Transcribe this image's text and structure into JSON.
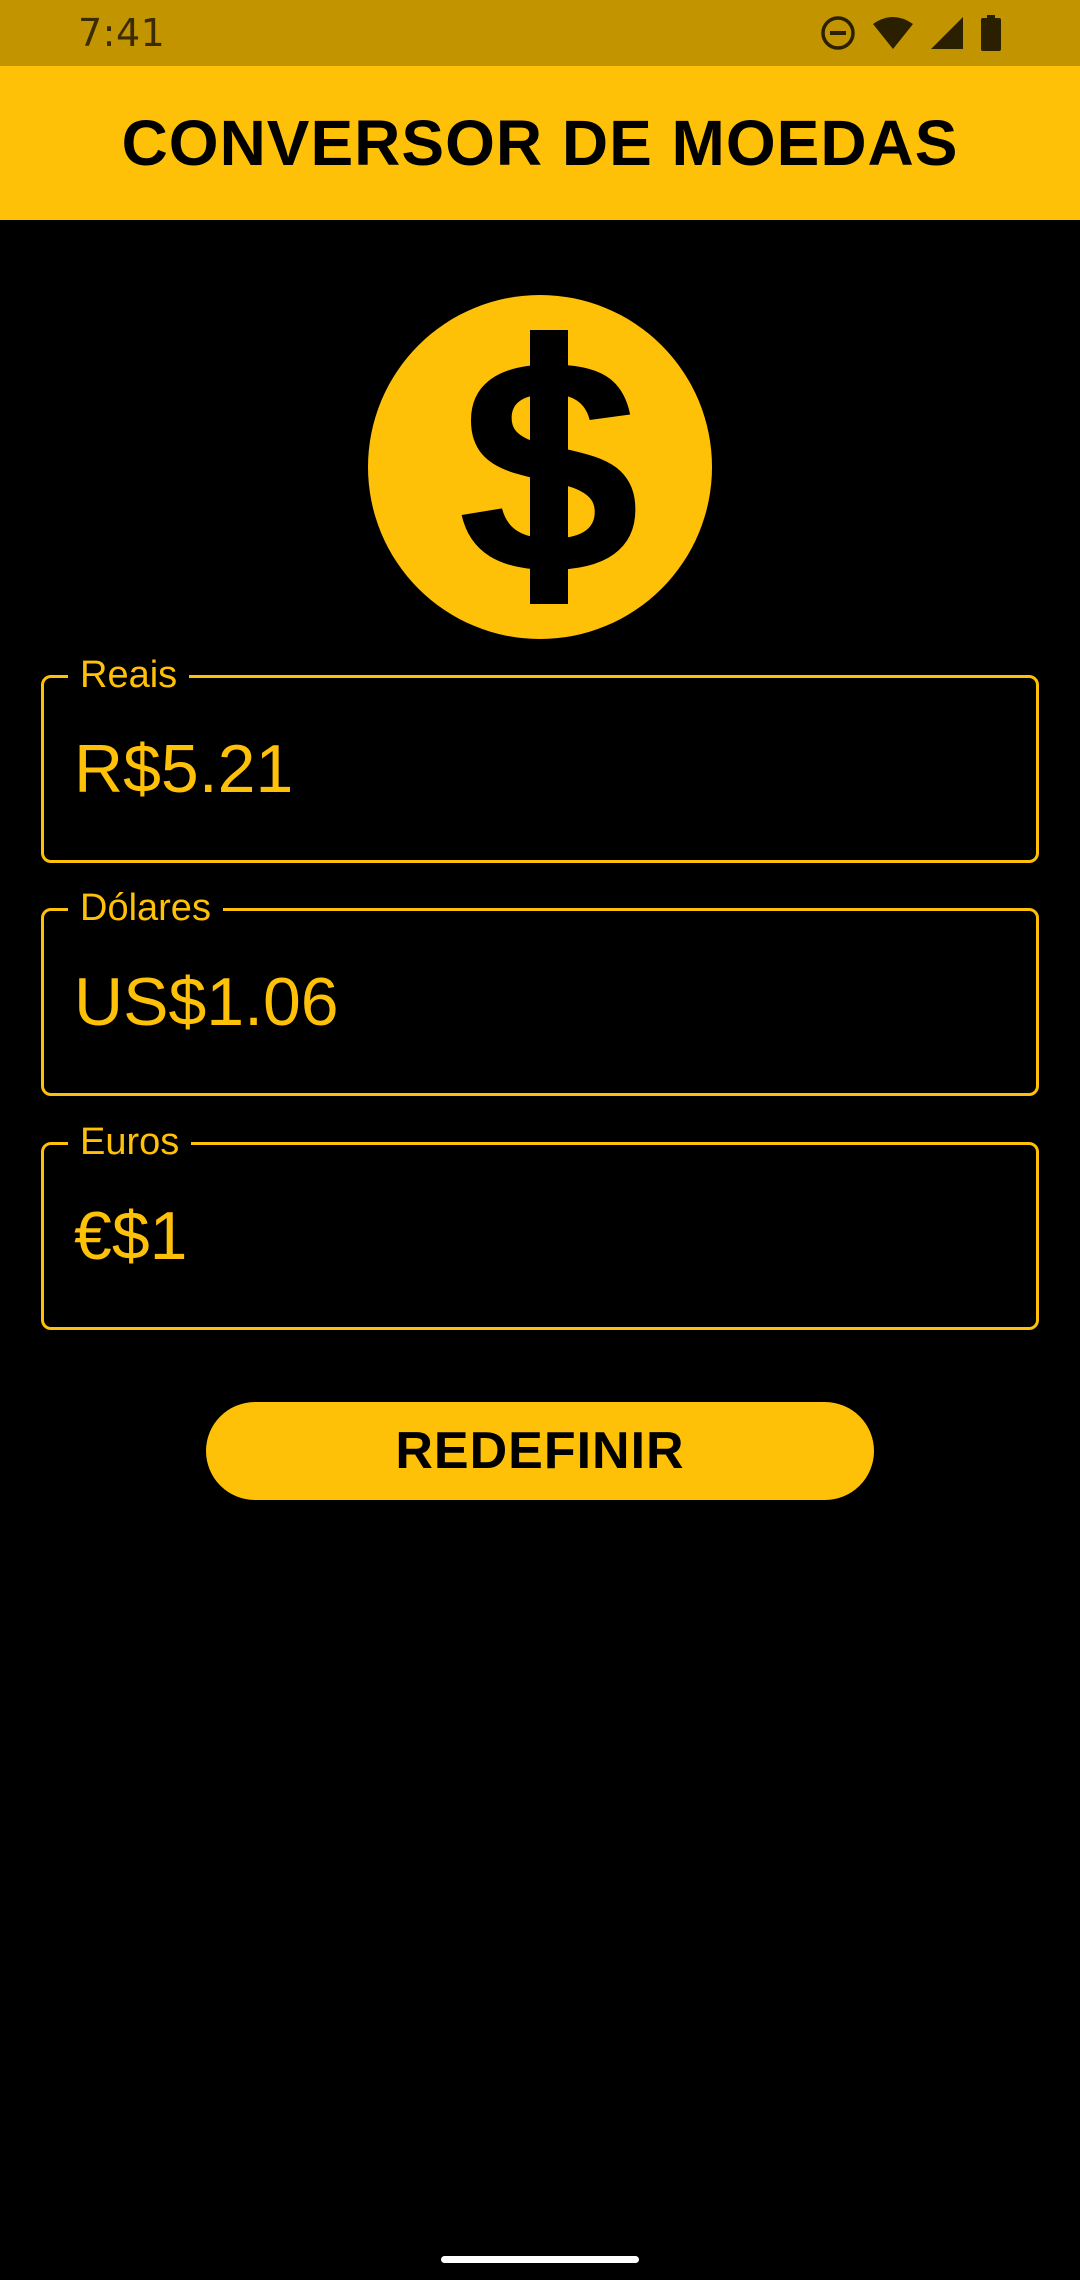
{
  "status_bar": {
    "time": "7:41",
    "icons": [
      "do-not-disturb-icon",
      "wifi-icon",
      "signal-icon",
      "battery-icon"
    ]
  },
  "app_bar": {
    "title": "CONVERSOR DE MOEDAS"
  },
  "hero_icon": "dollar-coin-icon",
  "fields": {
    "reais": {
      "label": "Reais",
      "value": "R$5.21"
    },
    "dolares": {
      "label": "Dólares",
      "value": "US$1.06"
    },
    "euros": {
      "label": "Euros",
      "value": "€$1"
    }
  },
  "reset_button": {
    "label": "REDEFINIR"
  },
  "colors": {
    "accent": "#FFC107",
    "status_bar": "#C29400",
    "background": "#000000",
    "on_accent": "#000000"
  }
}
